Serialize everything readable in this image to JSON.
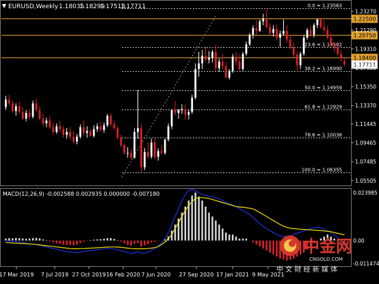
{
  "header": {
    "symbol": "EURUSD,Weekly",
    "open": "1.18035",
    "high": "1.18299",
    "low": "1.17513",
    "close": "1.17711"
  },
  "fibo_levels": [
    {
      "label": "0.0 = 1.23563",
      "price": 1.23563
    },
    {
      "label": "23.6 = 1.19502",
      "price": 1.19502
    },
    {
      "label": "38.2 = 1.16990",
      "price": 1.1699
    },
    {
      "label": "50.0 = 1.14959",
      "price": 1.14959
    },
    {
      "label": "61.8 = 1.12929",
      "price": 1.12929
    },
    {
      "label": "78.6 = 1.10038",
      "price": 1.10038
    },
    {
      "label": "100.0 = 1.06355",
      "price": 1.06355
    }
  ],
  "horizontal_lines": [
    {
      "label": "1.22500",
      "price": 1.225,
      "color": "#e0a030"
    },
    {
      "label": "1.20750",
      "price": 1.2075,
      "color": "#e0a030"
    },
    {
      "label": "1.18400",
      "price": 1.184,
      "color": "#e0a030"
    }
  ],
  "current_price": {
    "label": "1.17711",
    "price": 1.17711
  },
  "price_axis": {
    "ticks": [
      "1.23270",
      "1.21290",
      "1.19310",
      "1.17330",
      "1.15350",
      "1.13370",
      "1.11445",
      "1.09465",
      "1.07485",
      "1.05505"
    ],
    "range": [
      1.0506,
      1.243
    ]
  },
  "macd": {
    "label": "MACD(12,26,9) -0.002588 0.002935 0.000000 -0.007180",
    "axis_ticks": [
      "0.023985",
      "0.00",
      "-0.011474"
    ],
    "range": [
      -0.0125,
      0.0255
    ]
  },
  "time_axis": {
    "labels": [
      "17 Mar 2019",
      "7 Jul 2019",
      "27 Oct 2019",
      "16 Feb 2020",
      "7 Jun 2020",
      "27 Sep 2020",
      "17 Jan 2021",
      "9 May 2021"
    ]
  },
  "watermark": {
    "brand": "中金网",
    "domain": "CNGOLD.COM",
    "slogan": "中 文 财 经 新 媒 体"
  },
  "colors": {
    "bull": "#ffffff",
    "bear": "#e0202a",
    "macd_signal": "#f0e000",
    "macd_main": "#2030e0",
    "fib": "#c0c0c0",
    "hline": "#e0a030"
  },
  "chart_data": {
    "type": "candlestick",
    "ohlc": [
      [
        1.132,
        1.144,
        1.129,
        1.14
      ],
      [
        1.14,
        1.145,
        1.134,
        1.136
      ],
      [
        1.136,
        1.139,
        1.126,
        1.128
      ],
      [
        1.128,
        1.136,
        1.123,
        1.133
      ],
      [
        1.133,
        1.138,
        1.125,
        1.127
      ],
      [
        1.127,
        1.132,
        1.118,
        1.12
      ],
      [
        1.12,
        1.129,
        1.117,
        1.126
      ],
      [
        1.126,
        1.13,
        1.119,
        1.122
      ],
      [
        1.122,
        1.139,
        1.12,
        1.136
      ],
      [
        1.136,
        1.141,
        1.127,
        1.129
      ],
      [
        1.129,
        1.133,
        1.118,
        1.12
      ],
      [
        1.12,
        1.125,
        1.112,
        1.115
      ],
      [
        1.115,
        1.121,
        1.111,
        1.118
      ],
      [
        1.118,
        1.122,
        1.109,
        1.111
      ],
      [
        1.111,
        1.116,
        1.103,
        1.106
      ],
      [
        1.106,
        1.115,
        1.104,
        1.112
      ],
      [
        1.112,
        1.118,
        1.106,
        1.109
      ],
      [
        1.109,
        1.112,
        1.1,
        1.103
      ],
      [
        1.103,
        1.11,
        1.099,
        1.106
      ],
      [
        1.106,
        1.111,
        1.098,
        1.101
      ],
      [
        1.101,
        1.107,
        1.094,
        1.096
      ],
      [
        1.096,
        1.104,
        1.093,
        1.101
      ],
      [
        1.101,
        1.114,
        1.099,
        1.111
      ],
      [
        1.111,
        1.118,
        1.102,
        1.105
      ],
      [
        1.105,
        1.112,
        1.1,
        1.107
      ],
      [
        1.107,
        1.109,
        1.101,
        1.102
      ],
      [
        1.102,
        1.113,
        1.1,
        1.109
      ],
      [
        1.109,
        1.115,
        1.106,
        1.112
      ],
      [
        1.112,
        1.117,
        1.106,
        1.108
      ],
      [
        1.108,
        1.116,
        1.105,
        1.113
      ],
      [
        1.113,
        1.125,
        1.111,
        1.123
      ],
      [
        1.123,
        1.126,
        1.112,
        1.114
      ],
      [
        1.114,
        1.118,
        1.108,
        1.11
      ],
      [
        1.11,
        1.112,
        1.098,
        1.1
      ],
      [
        1.1,
        1.103,
        1.09,
        1.092
      ],
      [
        1.092,
        1.094,
        1.082,
        1.084
      ],
      [
        1.084,
        1.09,
        1.079,
        1.084
      ],
      [
        1.084,
        1.088,
        1.077,
        1.079
      ],
      [
        1.079,
        1.11,
        1.078,
        1.106
      ],
      [
        1.106,
        1.15,
        1.099,
        1.11
      ],
      [
        1.11,
        1.114,
        1.064,
        1.069
      ],
      [
        1.069,
        1.089,
        1.066,
        1.085
      ],
      [
        1.085,
        1.095,
        1.078,
        1.08
      ],
      [
        1.08,
        1.099,
        1.078,
        1.095
      ],
      [
        1.095,
        1.099,
        1.077,
        1.08
      ],
      [
        1.08,
        1.089,
        1.076,
        1.086
      ],
      [
        1.086,
        1.092,
        1.082,
        1.084
      ],
      [
        1.084,
        1.099,
        1.082,
        1.098
      ],
      [
        1.098,
        1.115,
        1.096,
        1.112
      ],
      [
        1.112,
        1.13,
        1.109,
        1.129
      ],
      [
        1.129,
        1.138,
        1.123,
        1.126
      ],
      [
        1.126,
        1.13,
        1.12,
        1.129
      ],
      [
        1.129,
        1.135,
        1.125,
        1.13
      ],
      [
        1.13,
        1.135,
        1.118,
        1.124
      ],
      [
        1.124,
        1.129,
        1.119,
        1.127
      ],
      [
        1.127,
        1.145,
        1.125,
        1.142
      ],
      [
        1.142,
        1.178,
        1.14,
        1.172
      ],
      [
        1.172,
        1.19,
        1.164,
        1.178
      ],
      [
        1.178,
        1.192,
        1.172,
        1.186
      ],
      [
        1.186,
        1.196,
        1.18,
        1.182
      ],
      [
        1.182,
        1.191,
        1.178,
        1.184
      ],
      [
        1.184,
        1.192,
        1.179,
        1.19
      ],
      [
        1.19,
        1.197,
        1.17,
        1.173
      ],
      [
        1.173,
        1.183,
        1.169,
        1.18
      ],
      [
        1.18,
        1.188,
        1.172,
        1.175
      ],
      [
        1.175,
        1.179,
        1.162,
        1.163
      ],
      [
        1.163,
        1.172,
        1.161,
        1.17
      ],
      [
        1.17,
        1.188,
        1.168,
        1.185
      ],
      [
        1.185,
        1.19,
        1.176,
        1.18
      ],
      [
        1.18,
        1.188,
        1.17,
        1.172
      ],
      [
        1.172,
        1.19,
        1.17,
        1.188
      ],
      [
        1.188,
        1.201,
        1.186,
        1.198
      ],
      [
        1.198,
        1.21,
        1.196,
        1.208
      ],
      [
        1.208,
        1.218,
        1.204,
        1.215
      ],
      [
        1.215,
        1.223,
        1.208,
        1.212
      ],
      [
        1.212,
        1.224,
        1.211,
        1.222
      ],
      [
        1.222,
        1.23,
        1.218,
        1.225
      ],
      [
        1.225,
        1.235,
        1.215,
        1.216
      ],
      [
        1.216,
        1.22,
        1.208,
        1.21
      ],
      [
        1.21,
        1.218,
        1.206,
        1.214
      ],
      [
        1.214,
        1.219,
        1.202,
        1.205
      ],
      [
        1.205,
        1.212,
        1.195,
        1.209
      ],
      [
        1.209,
        1.224,
        1.207,
        1.212
      ],
      [
        1.212,
        1.218,
        1.2,
        1.203
      ],
      [
        1.203,
        1.208,
        1.193,
        1.195
      ],
      [
        1.195,
        1.2,
        1.184,
        1.187
      ],
      [
        1.187,
        1.19,
        1.17,
        1.176
      ],
      [
        1.176,
        1.19,
        1.172,
        1.188
      ],
      [
        1.188,
        1.208,
        1.186,
        1.205
      ],
      [
        1.205,
        1.215,
        1.203,
        1.213
      ],
      [
        1.213,
        1.218,
        1.206,
        1.208
      ],
      [
        1.208,
        1.22,
        1.205,
        1.218
      ],
      [
        1.218,
        1.225,
        1.215,
        1.224
      ],
      [
        1.224,
        1.226,
        1.214,
        1.216
      ],
      [
        1.216,
        1.223,
        1.21,
        1.213
      ],
      [
        1.213,
        1.218,
        1.203,
        1.205
      ],
      [
        1.205,
        1.21,
        1.195,
        1.196
      ],
      [
        1.196,
        1.2,
        1.19,
        1.195
      ],
      [
        1.195,
        1.199,
        1.186,
        1.188
      ],
      [
        1.188,
        1.192,
        1.18,
        1.183
      ],
      [
        1.18035,
        1.18299,
        1.17513,
        1.17711
      ]
    ],
    "macd_hist": [
      0.001,
      0.0012,
      0.0011,
      0.0013,
      0.0012,
      0.001,
      0.0009,
      0.001,
      0.0012,
      0.0013,
      0.0011,
      0.0006,
      0.0002,
      -0.0004,
      -0.001,
      -0.0014,
      -0.0016,
      -0.002,
      -0.0022,
      -0.0021,
      -0.0024,
      -0.002,
      -0.0012,
      -0.0006,
      -0.0002,
      0.0002,
      0.0004,
      0.0006,
      0.0007,
      0.0009,
      0.0012,
      0.0012,
      0.0008,
      0.0002,
      -0.0006,
      -0.0014,
      -0.0022,
      -0.0026,
      -0.0016,
      -0.0012,
      -0.003,
      -0.0024,
      -0.0018,
      -0.001,
      -0.0006,
      -0.0002,
      0.0,
      0.0006,
      0.002,
      0.005,
      0.008,
      0.011,
      0.014,
      0.017,
      0.02,
      0.0225,
      0.024,
      0.022,
      0.02,
      0.017,
      0.014,
      0.012,
      0.01,
      0.008,
      0.006,
      0.004,
      0.003,
      0.003,
      0.002,
      0.001,
      0.001,
      0.001,
      0.0,
      -0.001,
      -0.002,
      -0.003,
      -0.004,
      -0.005,
      -0.006,
      -0.007,
      -0.008,
      -0.009,
      -0.0095,
      -0.01,
      -0.0096,
      -0.009,
      -0.008,
      -0.007,
      -0.006,
      -0.0045,
      -0.003,
      -0.0015,
      0.0,
      0.001,
      0.002,
      0.003,
      0.002,
      0.001,
      0.0,
      -0.001,
      -0.0026
    ],
    "macd_signal": [
      -0.001,
      -0.0011,
      -0.0012,
      -0.0013,
      -0.0014,
      -0.0015,
      -0.0016,
      -0.0017,
      -0.0018,
      -0.002,
      -0.0022,
      -0.0024,
      -0.0026,
      -0.0028,
      -0.003,
      -0.0032,
      -0.0034,
      -0.0036,
      -0.0038,
      -0.004,
      -0.0041,
      -0.0041,
      -0.004,
      -0.004,
      -0.0039,
      -0.0038,
      -0.0037,
      -0.0036,
      -0.0035,
      -0.0034,
      -0.0033,
      -0.0032,
      -0.0032,
      -0.0033,
      -0.0034,
      -0.0036,
      -0.0038,
      -0.004,
      -0.0041,
      -0.0041,
      -0.0041,
      -0.0041,
      -0.004,
      -0.0038,
      -0.0035,
      -0.003,
      -0.002,
      -0.0008,
      0.001,
      0.003,
      0.006,
      0.009,
      0.012,
      0.015,
      0.0175,
      0.0195,
      0.021,
      0.0215,
      0.0215,
      0.0213,
      0.021,
      0.0205,
      0.02,
      0.0195,
      0.019,
      0.0185,
      0.018,
      0.0175,
      0.017,
      0.0168,
      0.0166,
      0.0164,
      0.0162,
      0.0158,
      0.015,
      0.014,
      0.013,
      0.012,
      0.011,
      0.01,
      0.009,
      0.008,
      0.0072,
      0.0066,
      0.0062,
      0.006,
      0.0058,
      0.0056,
      0.0055,
      0.0054,
      0.0053,
      0.0052,
      0.0051,
      0.005,
      0.0048,
      0.0046,
      0.0044,
      0.004,
      0.0036,
      0.0032,
      0.0029
    ],
    "macd_main": [
      0.0,
      -0.0002,
      -0.0004,
      -0.0006,
      -0.0008,
      -0.001,
      -0.0013,
      -0.0016,
      -0.0018,
      -0.0021,
      -0.0024,
      -0.0028,
      -0.0032,
      -0.0036,
      -0.004,
      -0.0044,
      -0.0048,
      -0.0052,
      -0.0056,
      -0.0058,
      -0.006,
      -0.006,
      -0.0058,
      -0.0055,
      -0.0052,
      -0.005,
      -0.0048,
      -0.0046,
      -0.0044,
      -0.0042,
      -0.004,
      -0.004,
      -0.0042,
      -0.0046,
      -0.005,
      -0.0055,
      -0.006,
      -0.0066,
      -0.006,
      -0.0055,
      -0.0065,
      -0.0062,
      -0.0058,
      -0.005,
      -0.004,
      -0.0028,
      -0.001,
      0.001,
      0.004,
      0.008,
      0.012,
      0.016,
      0.02,
      0.023,
      0.025,
      0.0255,
      0.025,
      0.024,
      0.023,
      0.0225,
      0.0222,
      0.022,
      0.0215,
      0.0208,
      0.02,
      0.0192,
      0.0185,
      0.0178,
      0.017,
      0.016,
      0.015,
      0.014,
      0.013,
      0.0115,
      0.01,
      0.0085,
      0.007,
      0.006,
      0.005,
      0.004,
      0.003,
      0.0024,
      0.002,
      0.002,
      0.0024,
      0.003,
      0.0036,
      0.0042,
      0.0048,
      0.0054,
      0.006,
      0.0064,
      0.0066,
      0.0064,
      0.0058,
      0.005,
      0.004,
      0.0028,
      0.0014,
      0.0,
      -0.0026
    ]
  }
}
